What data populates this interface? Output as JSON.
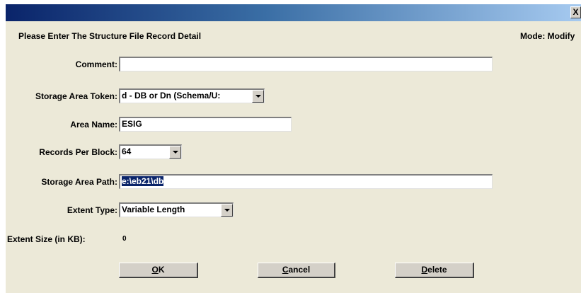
{
  "titlebar": {
    "close_glyph": "X"
  },
  "header": {
    "prompt": "Please Enter The Structure File Record Detail",
    "mode": "Mode:  Modify"
  },
  "form": {
    "comment_label": "Comment:",
    "comment_value": "",
    "token_label": "Storage Area Token:",
    "token_value": "d - DB or Dn (Schema/U:",
    "area_name_label": "Area Name:",
    "area_name_value": "ESIG",
    "records_label": "Records Per Block:",
    "records_value": "64",
    "path_label": "Storage Area Path:",
    "path_value": "e:\\eb21\\db",
    "extent_type_label": "Extent Type:",
    "extent_type_value": "Variable Length",
    "extent_size_label": "Extent Size (in KB):",
    "extent_size_value": "0"
  },
  "buttons": {
    "ok_underline": "O",
    "ok_rest": "K",
    "cancel_underline": "C",
    "cancel_rest": "ancel",
    "delete_underline": "D",
    "delete_rest": "elete"
  }
}
